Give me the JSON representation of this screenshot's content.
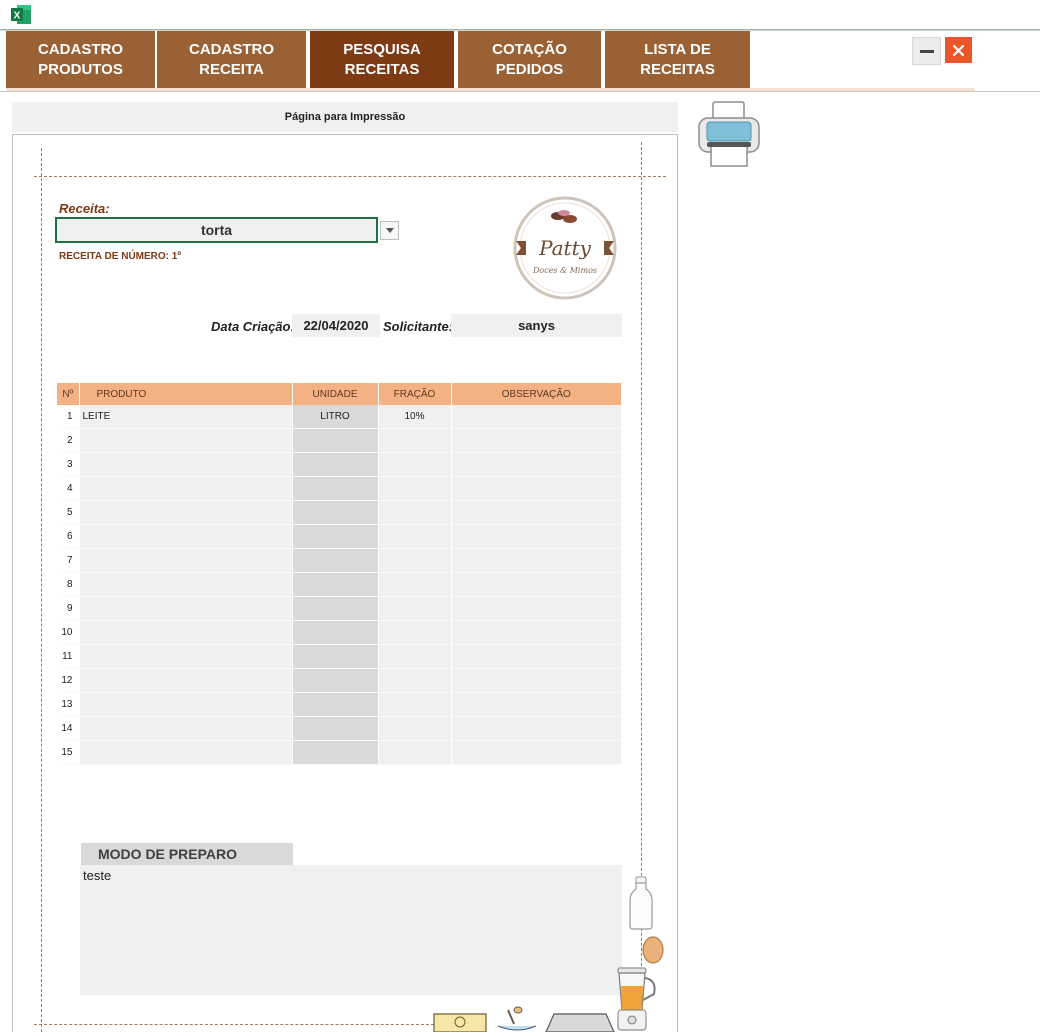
{
  "nav": [
    {
      "label": "CADASTRO\nPRODUTOS",
      "active": false
    },
    {
      "label": "CADASTRO\nRECEITA",
      "active": false
    },
    {
      "label": "PESQUISA\nRECEITAS",
      "active": true
    },
    {
      "label": "COTAÇÃO\nPEDIDOS",
      "active": false
    },
    {
      "label": "LISTA DE\nRECEITAS",
      "active": false
    }
  ],
  "page_header": "Página para Impressão",
  "receita": {
    "label": "Receita:",
    "value": "torta",
    "number_text": "RECEITA DE NÚMERO: 1º"
  },
  "logo": {
    "name": "Patty",
    "tagline": "Doces & Mimos"
  },
  "info": {
    "data_label": "Data Criação:",
    "data_value": "22/04/2020",
    "solicitante_label": "Solicitante:",
    "solicitante_value": "sanys"
  },
  "table": {
    "headers": [
      "Nº",
      "PRODUTO",
      "UNIDADE",
      "FRAÇÃO",
      "OBSERVAÇÃO"
    ],
    "rows": [
      {
        "n": "1",
        "produto": "LEITE",
        "unidade": "LITRO",
        "fracao": "10%",
        "obs": ""
      },
      {
        "n": "2",
        "produto": "",
        "unidade": "",
        "fracao": "",
        "obs": ""
      },
      {
        "n": "3",
        "produto": "",
        "unidade": "",
        "fracao": "",
        "obs": ""
      },
      {
        "n": "4",
        "produto": "",
        "unidade": "",
        "fracao": "",
        "obs": ""
      },
      {
        "n": "5",
        "produto": "",
        "unidade": "",
        "fracao": "",
        "obs": ""
      },
      {
        "n": "6",
        "produto": "",
        "unidade": "",
        "fracao": "",
        "obs": ""
      },
      {
        "n": "7",
        "produto": "",
        "unidade": "",
        "fracao": "",
        "obs": ""
      },
      {
        "n": "8",
        "produto": "",
        "unidade": "",
        "fracao": "",
        "obs": ""
      },
      {
        "n": "9",
        "produto": "",
        "unidade": "",
        "fracao": "",
        "obs": ""
      },
      {
        "n": "10",
        "produto": "",
        "unidade": "",
        "fracao": "",
        "obs": ""
      },
      {
        "n": "11",
        "produto": "",
        "unidade": "",
        "fracao": "",
        "obs": ""
      },
      {
        "n": "12",
        "produto": "",
        "unidade": "",
        "fracao": "",
        "obs": ""
      },
      {
        "n": "13",
        "produto": "",
        "unidade": "",
        "fracao": "",
        "obs": ""
      },
      {
        "n": "14",
        "produto": "",
        "unidade": "",
        "fracao": "",
        "obs": ""
      },
      {
        "n": "15",
        "produto": "",
        "unidade": "",
        "fracao": "",
        "obs": ""
      }
    ]
  },
  "modo": {
    "label": "MODO DE PREPARO",
    "text": "teste"
  },
  "icons": {
    "app": "excel-icon",
    "minimize": "minimize-icon",
    "close": "close-icon",
    "dropdown": "chevron-down-icon",
    "printer": "printer-icon"
  },
  "colors": {
    "nav": "#9a6134",
    "nav_active": "#7e3a12",
    "table_header": "#f4b183",
    "close_button": "#e8562a",
    "accent_text": "#7e3a12"
  }
}
